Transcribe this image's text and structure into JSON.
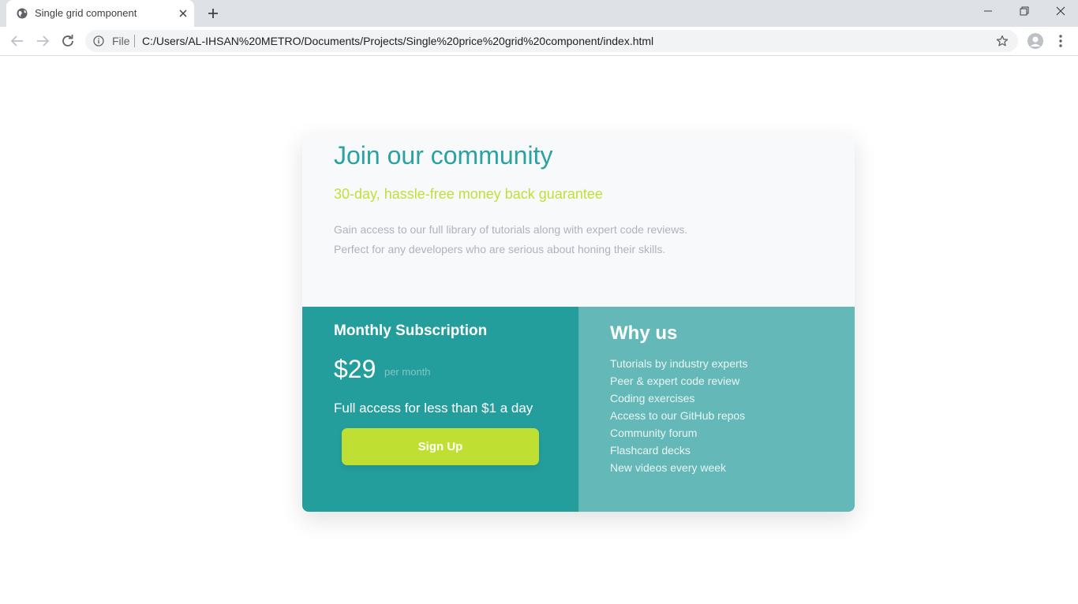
{
  "browser": {
    "tab_title": "Single grid component",
    "scheme_label": "File",
    "url": "C:/Users/AL-IHSAN%20METRO/Documents/Projects/Single%20price%20grid%20component/index.html"
  },
  "hero": {
    "title": "Join our community",
    "subtitle": "30-day, hassle-free money back guarantee",
    "description_lines": [
      "Gain access to our full library of tutorials along with expert code reviews.",
      "Perfect for any developers who are serious about honing their skills."
    ]
  },
  "subscription": {
    "title": "Monthly Subscription",
    "price": "$29",
    "period": "per month",
    "access_text": "Full access for less than $1 a day",
    "button_label": "Sign Up"
  },
  "why_us": {
    "title": "Why us",
    "items": [
      "Tutorials by industry experts",
      "Peer & expert code review",
      "Coding exercises",
      "Access to our GitHub repos",
      "Community forum",
      "Flashcard decks",
      "New videos every week"
    ]
  },
  "colors": {
    "title": "#2aa2a0",
    "subtitle": "#bfe039",
    "description": "#aeb2c0",
    "subscription_bg": "#249e9d",
    "why_us_bg": "#64b9b8",
    "button_bg": "#bfe033",
    "top_bg": "#f8f9fb"
  },
  "icons": {
    "favicon": "globe-icon",
    "tab_close": "close-icon",
    "new_tab": "plus-icon",
    "back": "back-arrow-icon",
    "forward": "forward-arrow-icon",
    "reload": "reload-icon",
    "site_info": "info-icon",
    "bookmark": "star-icon",
    "profile": "profile-icon",
    "menu": "kebab-menu-icon"
  }
}
